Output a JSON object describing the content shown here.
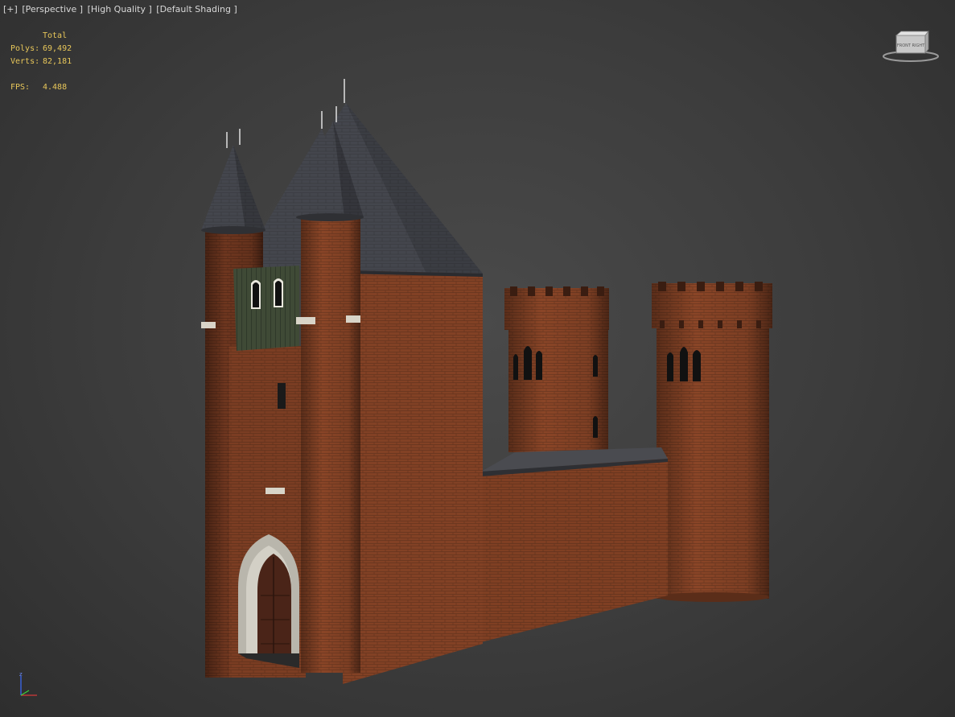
{
  "viewport": {
    "labels": [
      "[+]",
      "[Perspective ]",
      "[High Quality ]",
      "[Default Shading ]"
    ]
  },
  "stats": {
    "header": "Total",
    "polys_label": "Polys:",
    "polys_value": "69,492",
    "verts_label": "Verts:",
    "verts_value": "82,181",
    "fps_label": "FPS:",
    "fps_value": "4.488"
  },
  "viewcube": {
    "face_label": "FRONT  RIGHT"
  },
  "axis_tripod": {
    "z": "z"
  },
  "colors": {
    "brick": "#8a4527",
    "brick_dark": "#6a3420",
    "roof": "#3e4048",
    "stats_text": "#e8c75a",
    "label_text": "#d8d8d8"
  }
}
